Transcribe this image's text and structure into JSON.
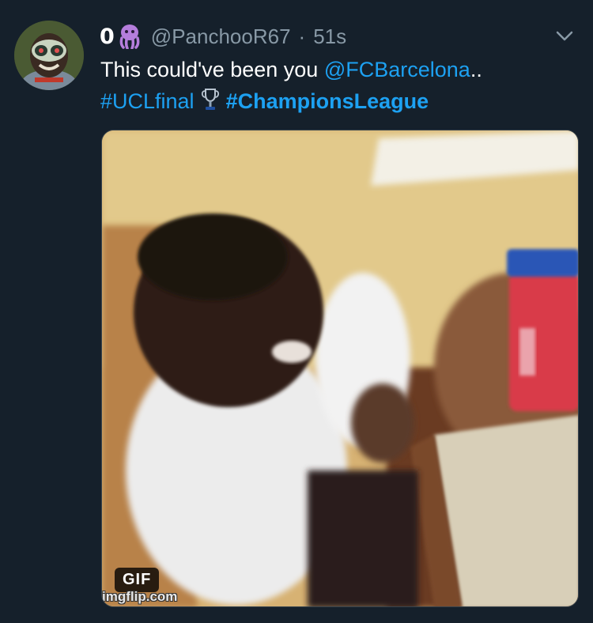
{
  "tweet": {
    "display_name": "0",
    "handle": "@PanchooR67",
    "separator": "·",
    "timestamp": "51s",
    "text_prefix": "This could've been you ",
    "mention": "@FCBarcelona",
    "text_suffix": "..",
    "hashtag_1": "#UCLfinal",
    "hashtag_2": "#ChampionsLeague",
    "display_name_emoji": "octopus-emoji",
    "hashtag_emoji": "trophy-emoji"
  },
  "media": {
    "badge": "GIF",
    "watermark": "imgflip.com"
  },
  "icons": {
    "menu": "chevron-down-icon"
  },
  "colors": {
    "background": "#15202b",
    "link": "#1da1f2",
    "secondary_text": "#8899a6",
    "primary_text": "#ffffff"
  }
}
